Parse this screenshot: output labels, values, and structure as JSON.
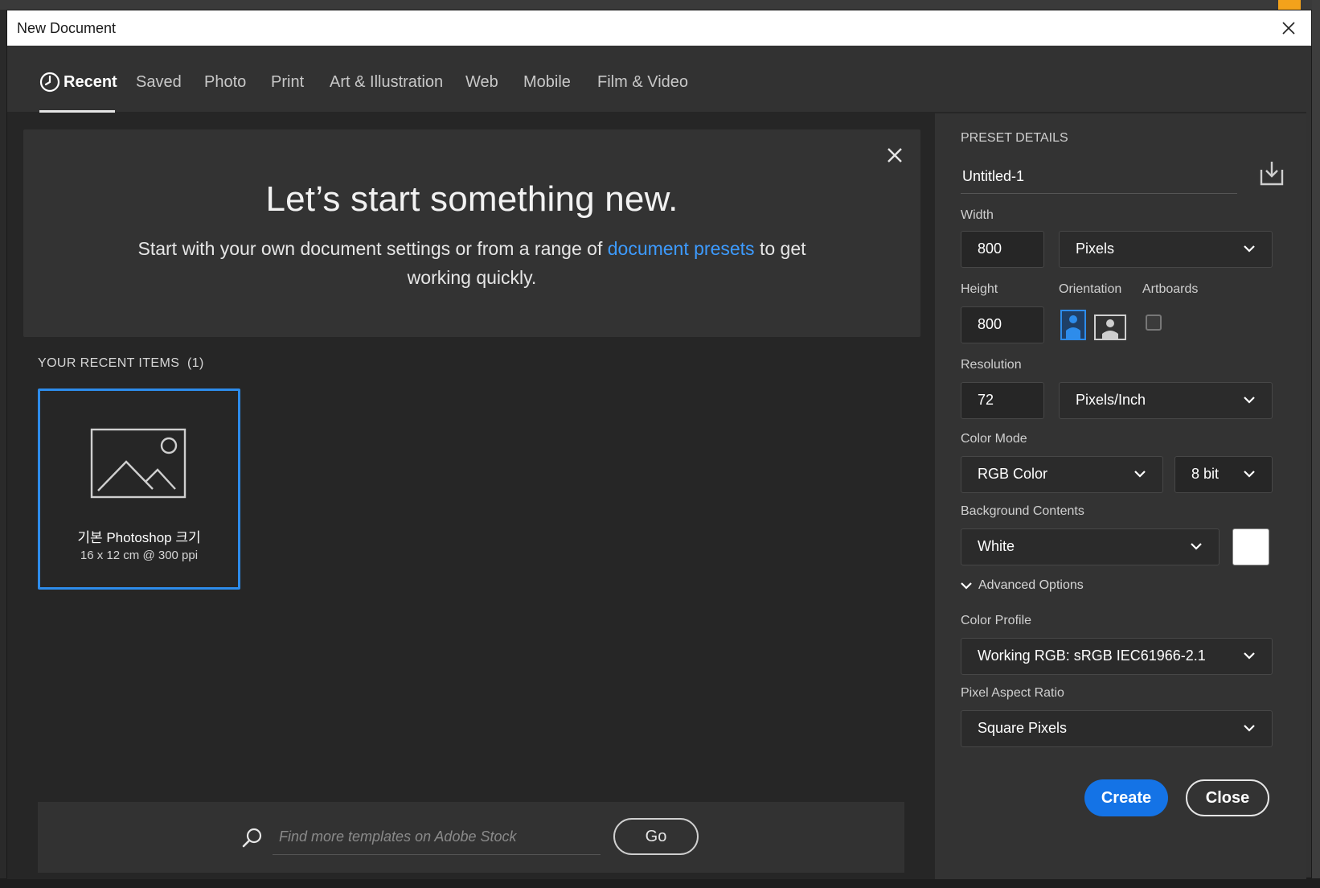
{
  "window": {
    "title": "New Document"
  },
  "tabs": [
    {
      "label": "Recent",
      "active": true
    },
    {
      "label": "Saved"
    },
    {
      "label": "Photo"
    },
    {
      "label": "Print"
    },
    {
      "label": "Art & Illustration"
    },
    {
      "label": "Web"
    },
    {
      "label": "Mobile"
    },
    {
      "label": "Film & Video"
    }
  ],
  "hero": {
    "title": "Let’s start something new.",
    "text_before": "Start with your own document settings or from a range of ",
    "link": "document presets",
    "text_after": " to get working quickly."
  },
  "recent": {
    "heading": "YOUR RECENT ITEMS",
    "count": "(1)",
    "items": [
      {
        "name": "기본 Photoshop 크기",
        "dims": "16 x 12 cm @ 300 ppi"
      }
    ]
  },
  "search": {
    "placeholder": "Find more templates on Adobe Stock",
    "go_label": "Go"
  },
  "preset": {
    "heading": "PRESET DETAILS",
    "name": "Untitled-1",
    "width_label": "Width",
    "width": "800",
    "width_unit": "Pixels",
    "height_label": "Height",
    "height": "800",
    "orientation_label": "Orientation",
    "artboards_label": "Artboards",
    "resolution_label": "Resolution",
    "resolution": "72",
    "resolution_unit": "Pixels/Inch",
    "color_mode_label": "Color Mode",
    "color_mode": "RGB Color",
    "bit_depth": "8 bit",
    "bg_contents_label": "Background Contents",
    "bg_contents": "White",
    "bg_swatch_color": "#ffffff",
    "advanced_label": "Advanced Options",
    "color_profile_label": "Color Profile",
    "color_profile": "Working RGB: sRGB IEC61966-2.1",
    "pixel_aspect_label": "Pixel Aspect Ratio",
    "pixel_aspect": "Square Pixels"
  },
  "actions": {
    "create": "Create",
    "close": "Close"
  },
  "colors": {
    "accent": "#1473e6",
    "link": "#3d9bff",
    "selection": "#2d8ceb"
  }
}
